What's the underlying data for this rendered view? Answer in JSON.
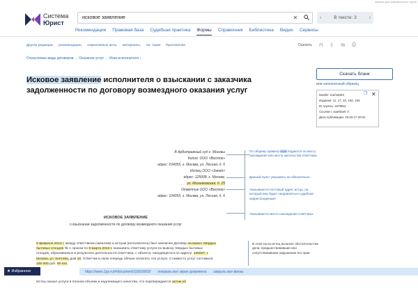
{
  "demo_notice": "версия для коммерческих орган",
  "logo": {
    "line1": "Система",
    "line2": "Юрист"
  },
  "search": {
    "value": "исковое заявление"
  },
  "nav_count": {
    "prev": "‹",
    "label": "В тексте: 3",
    "next": "›"
  },
  "menu": [
    "Рекомендации",
    "Правовая база",
    "Судебная практика",
    "Формы",
    "Справочник",
    "Библиотека",
    "Видео",
    "Сервисы"
  ],
  "menu_active": "Формы",
  "docbar": [
    "Другие редакции,",
    "рекомендации,",
    "нормативные акты,",
    "материалы,",
    "см. также",
    "Приложения"
  ],
  "tools": {
    "rate": "Оценить"
  },
  "breadcrumb": "Отраслевые виды договоров → Оказание услуг → Иски исполнителя ↓",
  "title": {
    "highlight": "Исковое заявление",
    "rest": " исполнителя о взыскании с заказчика задолженности по договору возмездного оказания услуг"
  },
  "download": {
    "button": "Скачать бланк",
    "alt_prefix": "или ",
    "alt_link": "заполненный образец"
  },
  "info": {
    "modid": "ModID: 116/16003",
    "editions": "Издания: 11, 17, 22, 192, 193",
    "group": "ID группы: 1678511",
    "errors": "Ссылки с ошибкой: 0",
    "published": "Дата публикации: 23.03.17 20:02"
  },
  "doc": {
    "recipient": [
      "В Арбитражный суд г. Москвы",
      "Копия: ООО «Восток»",
      "адрес: 104055, г. Москва, ул. Лесная, д. 6",
      "Истец ООО «Запад»",
      "адрес: 125008, г. Москва,",
      "ул. Михалковская, д. 25",
      "Ответчик ООО «Восток»",
      "адрес: 104055, г. Москва, ул. Лесная, д. 6"
    ],
    "heading": "ИСКОВОЕ ЗАЯВЛЕНИЕ",
    "subheading": "о взыскании задолженности по договору возмездного оказания услуг",
    "para1": [
      {
        "t": "6 февраля 2013 г.",
        "y": true
      },
      {
        "t": " между ответчиком (заказчик) и истцом (исполнитель) был заключен Договор ",
        "y": false
      },
      {
        "t": "на вывоз твердых бытовых отходов",
        "y": true
      },
      {
        "t": " № 1 сроком по ",
        "y": false
      },
      {
        "t": "6 марта 2013 г.",
        "y": true
      },
      {
        "t": " оказывать ответчику услуги по вывозу твердых бытовых отходов, образованных в результате деятельности ответчика, с объекта, находящегося по адресу: ",
        "y": false
      },
      {
        "t": "125007, г. Москва, ул. Коптева,",
        "y": true
      },
      {
        "t": " дом ",
        "y": false
      },
      {
        "t": "40",
        "y": true
      },
      {
        "t": ". Ответчик в свою очередь обязан оплатить эти услуги. Стоимость услуг составила ",
        "y": false
      },
      {
        "t": "100 000",
        "y": true
      },
      {
        "t": " руб. ",
        "y": false
      },
      {
        "t": "00 коп.",
        "y": true
      }
    ],
    "bottom_line": {
      "t1": "Истец оказал услуги в полном объеме и надлежащего качества, что подтверждается ",
      "y1": "актом об"
    }
  },
  "comments": [
    {
      "pre": "По общему правилу ",
      "hl": "иски",
      "post": " подаются по месту нахождения или месту жительства ответчика"
    },
    {
      "pre": "Данный пункт указывать не обязательно",
      "hl": "",
      "post": ""
    },
    {
      "pre": "Указываются почтовый адрес истца, на который ему будет направляться судебная корреспонденция",
      "hl": "",
      "post": ""
    },
    {
      "pre": "Указываются место нахождения ответчика",
      "hl": "",
      "post": ""
    }
  ],
  "comment_plain": "В этой части истец излагает обстоятельства дела, предшествовавшие или сопутствовавшие нарушению его прав",
  "favorites": "★ Избранное",
  "urlbar": {
    "url": "https://www.1jur.ru/#/document/118/16003/",
    "link1": "показать все экран документа",
    "link2": "закрыть все врезы"
  }
}
